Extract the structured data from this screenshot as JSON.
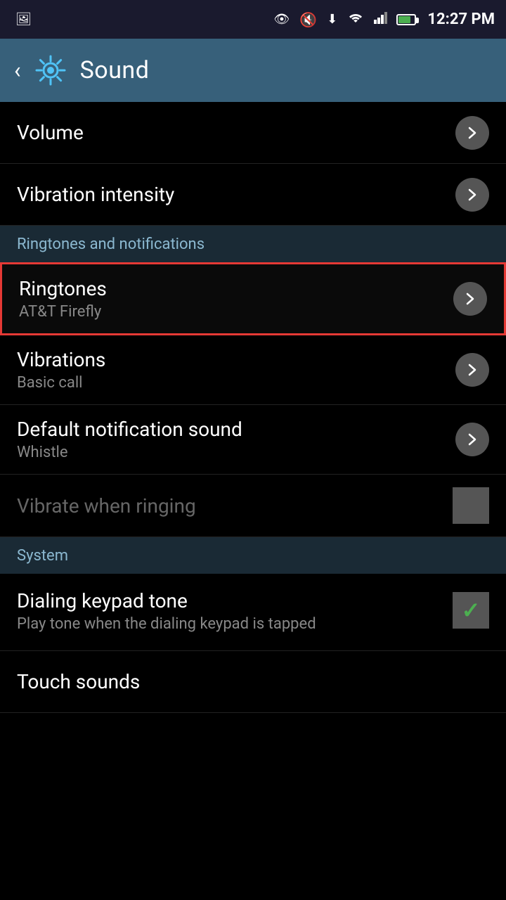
{
  "statusBar": {
    "time": "12:27 PM",
    "icons": [
      "image-icon",
      "eye-icon",
      "mute-icon",
      "download-icon",
      "signal-icon",
      "battery-icon"
    ]
  },
  "appBar": {
    "title": "Sound",
    "backLabel": "‹",
    "gearIconName": "gear-icon"
  },
  "sections": [
    {
      "items": [
        {
          "id": "volume",
          "title": "Volume",
          "subtitle": "",
          "hasChevron": true,
          "highlighted": false,
          "dimmed": false,
          "control": "chevron"
        },
        {
          "id": "vibration-intensity",
          "title": "Vibration intensity",
          "subtitle": "",
          "hasChevron": true,
          "highlighted": false,
          "dimmed": false,
          "control": "chevron"
        }
      ]
    },
    {
      "header": "Ringtones and notifications",
      "items": [
        {
          "id": "ringtones",
          "title": "Ringtones",
          "subtitle": "AT&T Firefly",
          "hasChevron": true,
          "highlighted": true,
          "dimmed": false,
          "control": "chevron"
        },
        {
          "id": "vibrations",
          "title": "Vibrations",
          "subtitle": "Basic call",
          "hasChevron": true,
          "highlighted": false,
          "dimmed": false,
          "control": "chevron"
        },
        {
          "id": "default-notification-sound",
          "title": "Default notification sound",
          "subtitle": "Whistle",
          "hasChevron": true,
          "highlighted": false,
          "dimmed": false,
          "control": "chevron"
        },
        {
          "id": "vibrate-when-ringing",
          "title": "Vibrate when ringing",
          "subtitle": "",
          "hasChevron": false,
          "highlighted": false,
          "dimmed": true,
          "control": "checkbox-unchecked"
        }
      ]
    },
    {
      "header": "System",
      "items": [
        {
          "id": "dialing-keypad-tone",
          "title": "Dialing keypad tone",
          "subtitle": "Play tone when the dialing keypad is tapped",
          "hasChevron": false,
          "highlighted": false,
          "dimmed": false,
          "control": "checkbox-checked"
        },
        {
          "id": "touch-sounds",
          "title": "Touch sounds",
          "subtitle": "",
          "hasChevron": false,
          "highlighted": false,
          "dimmed": false,
          "control": "none"
        }
      ]
    }
  ]
}
